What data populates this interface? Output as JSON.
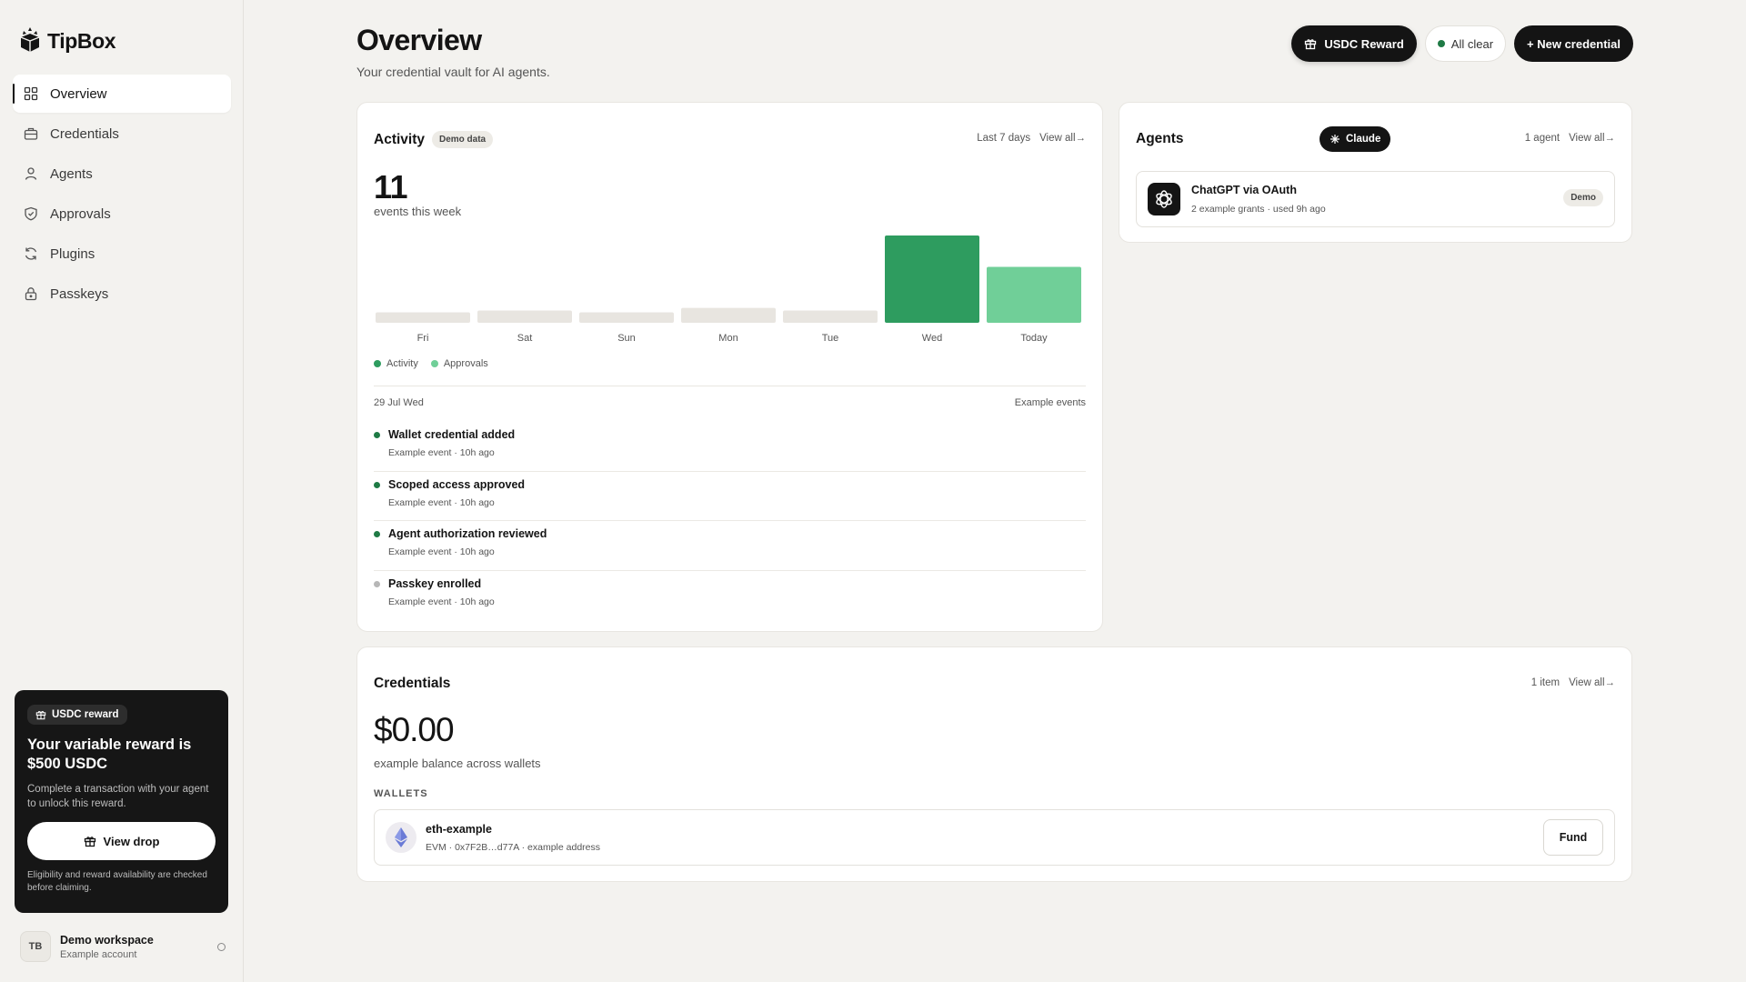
{
  "app": {
    "name": "TipBox"
  },
  "sidebar": {
    "items": [
      {
        "label": "Overview",
        "icon": "grid-icon",
        "active": true
      },
      {
        "label": "Credentials",
        "icon": "briefcase-icon",
        "active": false
      },
      {
        "label": "Agents",
        "icon": "user-icon",
        "active": false
      },
      {
        "label": "Approvals",
        "icon": "shield-check-icon",
        "active": false
      },
      {
        "label": "Plugins",
        "icon": "refresh-icon",
        "active": false
      },
      {
        "label": "Passkeys",
        "icon": "lock-icon",
        "active": false
      }
    ],
    "reward": {
      "chip": "USDC reward",
      "title": "Your variable reward is $500 USDC",
      "description": "Complete a transaction with your agent to unlock this reward.",
      "button": "View drop",
      "note": "Eligibility and reward availability are checked before claiming."
    },
    "workspace": {
      "initials": "TB",
      "name": "Demo workspace",
      "subtitle": "Example account"
    }
  },
  "header": {
    "title": "Overview",
    "subtitle": "Your credential vault for AI agents.",
    "usdc_button": "USDC Reward",
    "status_label": "All clear",
    "new_credential": "+ New credential"
  },
  "activity": {
    "title": "Activity",
    "badge": "Demo data",
    "range": "Last 7 days",
    "view_all": "View all→",
    "count": "11",
    "count_label": "events this week",
    "legend": {
      "activity": "Activity",
      "approvals": "Approvals"
    },
    "date": "29 Jul Wed",
    "example_label": "Example events",
    "events": [
      {
        "title": "Wallet credential added",
        "sub": "Example event · 10h ago",
        "muted": false
      },
      {
        "title": "Scoped access approved",
        "sub": "Example event · 10h ago",
        "muted": false
      },
      {
        "title": "Agent authorization reviewed",
        "sub": "Example event · 10h ago",
        "muted": false
      },
      {
        "title": "Passkey enrolled",
        "sub": "Example event · 10h ago",
        "muted": true
      }
    ]
  },
  "chart_data": {
    "type": "bar",
    "categories": [
      "Fri",
      "Sat",
      "Sun",
      "Mon",
      "Tue",
      "Wed",
      "Today"
    ],
    "values": [
      0.12,
      0.14,
      0.12,
      0.17,
      0.14,
      1.0,
      0.64
    ],
    "kinds": [
      "empty",
      "empty",
      "empty",
      "empty",
      "empty",
      "activity",
      "approvals"
    ],
    "colors": {
      "activity": "#2e9c5f",
      "approvals": "#70cf98",
      "empty": "#e8e5e0"
    },
    "legend": [
      "Activity",
      "Approvals"
    ],
    "ylim": [
      0,
      1
    ]
  },
  "agents": {
    "title": "Agents",
    "claude_label": "Claude",
    "count": "1 agent",
    "view_all": "View all→",
    "item": {
      "name": "ChatGPT via OAuth",
      "sub": "2 example grants · used 9h ago",
      "badge": "Demo"
    }
  },
  "credentials": {
    "title": "Credentials",
    "count": "1 item",
    "view_all": "View all→",
    "balance": "$0.00",
    "balance_label": "example balance across wallets",
    "wallets_label": "WALLETS",
    "wallet": {
      "name": "eth-example",
      "sub": "EVM · 0x7F2B…d77A · example address",
      "fund": "Fund"
    }
  }
}
